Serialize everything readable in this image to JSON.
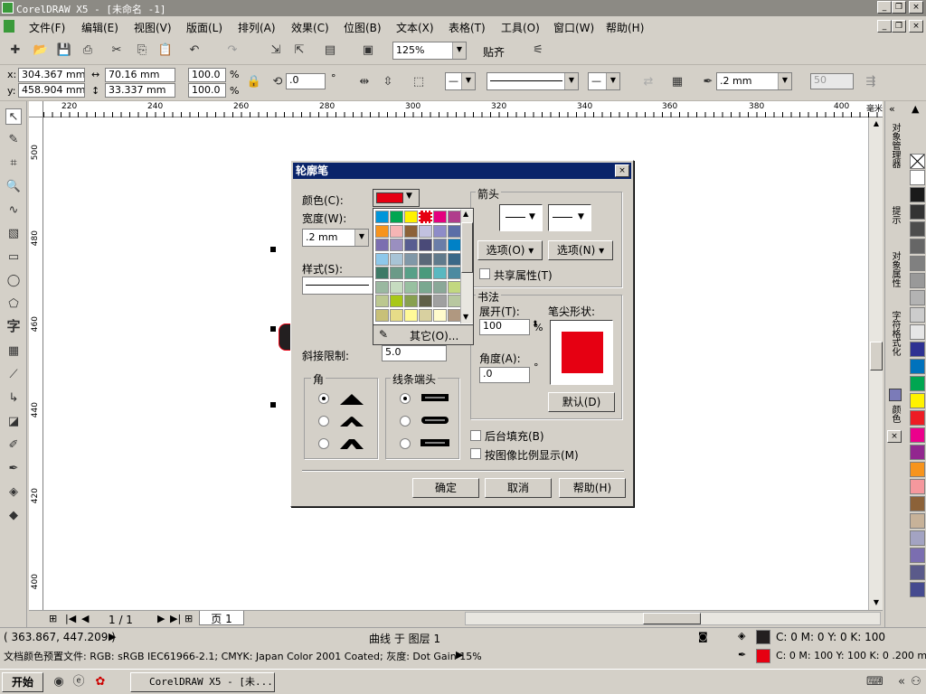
{
  "window": {
    "title": "CorelDRAW X5 - [未命名 -1]",
    "minimize": "_",
    "restore": "❐",
    "close": "×"
  },
  "menu": [
    "文件(F)",
    "编辑(E)",
    "视图(V)",
    "版面(L)",
    "排列(A)",
    "效果(C)",
    "位图(B)",
    "文本(X)",
    "表格(T)",
    "工具(O)",
    "窗口(W)",
    "帮助(H)"
  ],
  "toolbar": {
    "zoom": "125%",
    "snap": "贴齐"
  },
  "propbar": {
    "x_label": "x:",
    "x": "304.367 mm",
    "y_label": "y:",
    "y": "458.904 mm",
    "w": "70.16 mm",
    "h": "33.337 mm",
    "sx": "100.0",
    "sy": "100.0",
    "pct": "%",
    "angle": ".0",
    "deg": "°",
    "outline_width": ".2 mm",
    "node_count": "50"
  },
  "hruler": [
    "220",
    "240",
    "260",
    "280",
    "300",
    "320",
    "340",
    "360",
    "380",
    "400",
    "毫米"
  ],
  "vruler": [
    "500",
    "480",
    "460",
    "440",
    "420",
    "400"
  ],
  "page_nav": {
    "page": "1 / 1",
    "tab": "页 1"
  },
  "dockers": [
    "对象管理器",
    "提示",
    "对象属性",
    "字符格式化",
    "颜色"
  ],
  "palette_colors": [
    "#ffffff",
    "#1a1a1a",
    "#333333",
    "#4d4d4d",
    "#666666",
    "#808080",
    "#999999",
    "#b3b3b3",
    "#cccccc",
    "#e6e6e6",
    "#2e3192",
    "#0072bc",
    "#00a651",
    "#fff200",
    "#ed1c24",
    "#ec008c",
    "#92278f",
    "#f7941d",
    "#f5989d",
    "#8c6239",
    "#c7b299",
    "#a3a3c2",
    "#7b6eb0",
    "#5a5a8a",
    "#454a8f"
  ],
  "status": {
    "coords": "( 363.867, 447.209 )",
    "object": "曲线 于 图层 1",
    "profile": "文档颜色预置文件: RGB: sRGB IEC61966-2.1; CMYK: Japan Color 2001 Coated; 灰度: Dot Gain 15%",
    "fill": "C: 0 M: 0 Y: 0 K: 100",
    "outline": "C: 0 M: 100 Y: 100 K: 0  .200 mm",
    "fill_color": "#231f20",
    "outline_color": "#e60012"
  },
  "taskbar": {
    "start": "开始",
    "task": "CorelDRAW X5 - [未..."
  },
  "dialog": {
    "title": "轮廓笔",
    "color_label": "颜色(C):",
    "color_value": "#e60012",
    "width_label": "宽度(W):",
    "width_value": ".2 mm",
    "style_label": "样式(S):",
    "miter_label": "斜接限制:",
    "miter_value": "5.0",
    "corners_label": "角",
    "caps_label": "线条端头",
    "arrows_label": "箭头",
    "options1": "选项(O)",
    "options2": "选项(N)",
    "share": "共享属性(T)",
    "calligraphy_label": "书法",
    "stretch_label": "展开(T):",
    "stretch_value": "100",
    "stretch_unit": "%",
    "angle_label": "角度(A):",
    "angle_value": ".0",
    "angle_unit": "°",
    "nib_label": "笔尖形状:",
    "default_btn": "默认(D)",
    "behind_fill": "后台填充(B)",
    "scale_with_image": "按图像比例显示(M)",
    "ok": "确定",
    "cancel": "取消",
    "help": "帮助(H)",
    "other": "其它(O)..."
  },
  "picker_colors": [
    "#0095da",
    "#00a651",
    "#fff200",
    "#e60012",
    "#e4007f",
    "#b03d8c",
    "#f7941d",
    "#f5b5b5",
    "#8c6239",
    "#c2c1e0",
    "#8e8cc8",
    "#5b6ea7",
    "#7b6eb0",
    "#9a8fc0",
    "#585d91",
    "#4a4a78",
    "#6a7da8",
    "#0081c6",
    "#8ec8ea",
    "#a8c4d6",
    "#8098a8",
    "#5a6878",
    "#607a8c",
    "#3a6888",
    "#3d7a66",
    "#6b9a88",
    "#58a088",
    "#4a9a7c",
    "#5ab8c0",
    "#4c8aa0",
    "#9ab8a0",
    "#c6dcc0",
    "#98c0a0",
    "#7aa890",
    "#8aa898",
    "#c2d880",
    "#bcc890",
    "#a8c818",
    "#88a050",
    "#606048",
    "#a0a0a0",
    "#b8c8a0",
    "#c8c078",
    "#e6dc88",
    "#fffa98",
    "#d8d0a0",
    "#fffbcc",
    "#b09880"
  ]
}
